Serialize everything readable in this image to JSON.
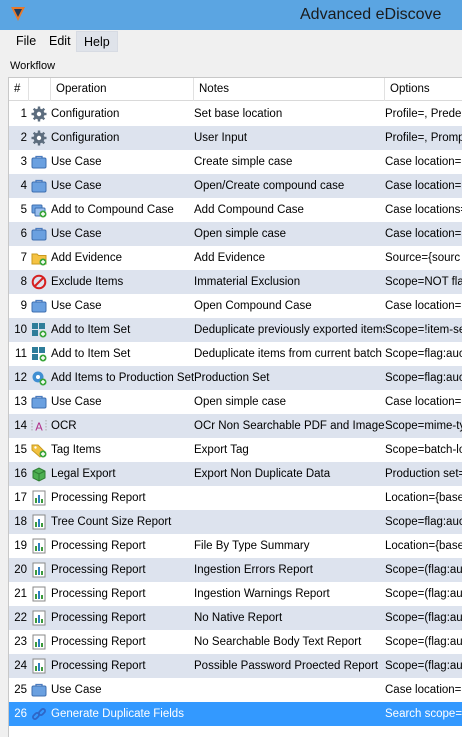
{
  "window": {
    "title": "Advanced eDiscove"
  },
  "menu": {
    "file": "File",
    "edit": "Edit",
    "help": "Help"
  },
  "group_label": "Workflow",
  "columns": {
    "num": "#",
    "operation": "Operation",
    "notes": "Notes",
    "options": "Options"
  },
  "rows": [
    {
      "num": "1",
      "icon": "gear-icon",
      "operation": "Configuration",
      "notes": "Set base location",
      "options": "Profile=, Prede"
    },
    {
      "num": "2",
      "icon": "gear-icon",
      "operation": "Configuration",
      "notes": "User Input",
      "options": "Profile=, Promp"
    },
    {
      "num": "3",
      "icon": "case-icon",
      "operation": "Use Case",
      "notes": "Create simple case",
      "options": "Case location="
    },
    {
      "num": "4",
      "icon": "case-icon",
      "operation": "Use Case",
      "notes": "Open/Create compound case",
      "options": "Case location="
    },
    {
      "num": "5",
      "icon": "compound-case-icon",
      "operation": "Add to Compound Case",
      "notes": "Add Compound Case",
      "options": "Case locations="
    },
    {
      "num": "6",
      "icon": "case-icon",
      "operation": "Use Case",
      "notes": "Open simple case",
      "options": "Case location="
    },
    {
      "num": "7",
      "icon": "add-evidence-icon",
      "operation": "Add Evidence",
      "notes": "Add Evidence",
      "options": "Source={sourc"
    },
    {
      "num": "8",
      "icon": "exclude-icon",
      "operation": "Exclude Items",
      "notes": "Immaterial Exclusion",
      "options": "Scope=NOT fla"
    },
    {
      "num": "9",
      "icon": "case-icon",
      "operation": "Use Case",
      "notes": "Open Compound Case",
      "options": "Case location="
    },
    {
      "num": "10",
      "icon": "item-set-icon",
      "operation": "Add to Item Set",
      "notes": "Deduplicate previously exported items",
      "options": "Scope=!item-se"
    },
    {
      "num": "11",
      "icon": "item-set-icon",
      "operation": "Add to Item Set",
      "notes": "Deduplicate items from current batch",
      "options": "Scope=flag:auc"
    },
    {
      "num": "12",
      "icon": "production-set-icon",
      "operation": "Add Items to Production Set",
      "notes": "Production Set",
      "options": "Scope=flag:auc"
    },
    {
      "num": "13",
      "icon": "case-icon",
      "operation": "Use Case",
      "notes": "Open simple case",
      "options": "Case location="
    },
    {
      "num": "14",
      "icon": "ocr-icon",
      "operation": "OCR",
      "notes": "OCr Non Searchable PDF and Images",
      "options": "Scope=mime-ty"
    },
    {
      "num": "15",
      "icon": "tag-icon",
      "operation": "Tag Items",
      "notes": "Export Tag",
      "options": "Scope=batch-lo"
    },
    {
      "num": "16",
      "icon": "legal-export-icon",
      "operation": "Legal Export",
      "notes": "Export Non Duplicate Data",
      "options": "Production set="
    },
    {
      "num": "17",
      "icon": "report-icon",
      "operation": "Processing Report",
      "notes": "",
      "options": "Location={base"
    },
    {
      "num": "18",
      "icon": "report-icon",
      "operation": "Tree Count Size Report",
      "notes": "",
      "options": "Scope=flag:auc"
    },
    {
      "num": "19",
      "icon": "report-icon",
      "operation": "Processing Report",
      "notes": "File By Type Summary",
      "options": "Location={base"
    },
    {
      "num": "20",
      "icon": "report-icon",
      "operation": "Processing Report",
      "notes": "Ingestion Errors Report",
      "options": "Scope=(flag:au"
    },
    {
      "num": "21",
      "icon": "report-icon",
      "operation": "Processing Report",
      "notes": "Ingestion Warnings Report",
      "options": "Scope=(flag:au"
    },
    {
      "num": "22",
      "icon": "report-icon",
      "operation": "Processing Report",
      "notes": "No Native Report",
      "options": "Scope=(flag:au"
    },
    {
      "num": "23",
      "icon": "report-icon",
      "operation": "Processing Report",
      "notes": "No Searchable Body Text Report",
      "options": "Scope=(flag:au"
    },
    {
      "num": "24",
      "icon": "report-icon",
      "operation": "Processing Report",
      "notes": "Possible Password Proected Report",
      "options": "Scope=(flag:au"
    },
    {
      "num": "25",
      "icon": "case-icon",
      "operation": "Use Case",
      "notes": "",
      "options": "Case location="
    },
    {
      "num": "26",
      "icon": "link-icon",
      "operation": "Generate Duplicate Fields",
      "notes": "",
      "options": "Search scope="
    }
  ],
  "selected_row": "26",
  "colors": {
    "titlebar": "#5ba5e2",
    "alt_row": "#dde3ee",
    "selected_row": "#3399ff"
  }
}
